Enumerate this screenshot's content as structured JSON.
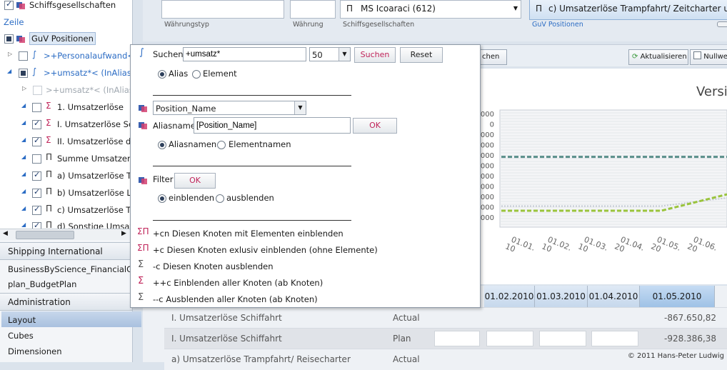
{
  "tree": {
    "top_item": "Schiffsgesellschaften",
    "section_label": "Zeile",
    "guv_label": "GuV Positionen",
    "items": [
      {
        "label": ">+Personalaufwand<"
      },
      {
        "label": ">+umsatz*< (InAlias)"
      },
      {
        "label": ">+umsatz*< (InAlias)"
      },
      {
        "label": "1. Umsatzerlöse"
      },
      {
        "label": "I. Umsatzerlöse Sch"
      },
      {
        "label": "II. Umsatzerlöse de"
      },
      {
        "label": "Summe Umsatzerl"
      },
      {
        "label": "a) Umsatzerlöse Tra"
      },
      {
        "label": "b) Umsatzerlöse Lir"
      },
      {
        "label": "c) Umsatzerlöse Tra"
      },
      {
        "label": "d) Sonstige Umsatz"
      }
    ]
  },
  "nav": {
    "header1": "Shipping International",
    "item1": "BusinessByScience_FinancialCub",
    "item2": "plan_BudgetPlan",
    "header2": "Administration",
    "layout": "Layout",
    "cubes": "Cubes",
    "dimensionen": "Dimensionen"
  },
  "filters": {
    "label1": "Währungstyp",
    "label2": "Währung",
    "label3": "Schiffsgesellschaften",
    "ship_value": "MS Icoaraci (612)",
    "guv_value": "c) Umsatzerlöse Trampfahrt/ Zeitcharter und ähr",
    "guv_label": "GuV Positionen"
  },
  "toolbar": {
    "partial": "chen",
    "refresh": "Aktualisieren",
    "nullwerte": "Nullwer"
  },
  "chart": {
    "title": "Versi"
  },
  "chart_data": {
    "type": "line",
    "title": "Versi",
    "y_tick_labels": [
      "000",
      "0",
      "000",
      "000",
      "000",
      "000",
      "000",
      "000",
      "000",
      "000",
      "000"
    ],
    "x": [
      "01.01.2010",
      "01.02.2010",
      "01.03.2010",
      "01.04.2010",
      "01.05.2010",
      "01.06.2010"
    ],
    "x_tick_labels": [
      [
        "01.01.",
        "10"
      ],
      [
        "01.02.",
        "10"
      ],
      [
        "01.03.",
        "10"
      ],
      [
        "01.04.",
        "20"
      ],
      [
        "01.05.",
        "20"
      ],
      [
        "01.06.",
        "20"
      ]
    ],
    "series": [
      {
        "values": [
          4.0,
          4.0,
          4.0,
          4.0,
          4.0,
          4.0
        ],
        "color": "#5a8f8a",
        "style": "dashed"
      },
      {
        "values": [
          8.2,
          8.2,
          8.2,
          8.2,
          8.2,
          7.5
        ],
        "color": "#c5cbd4",
        "style": "dotted"
      },
      {
        "values": [
          8.6,
          8.6,
          8.6,
          8.6,
          8.6,
          7.2
        ],
        "color": "#9ac43c",
        "style": "dashed"
      }
    ],
    "ylim": [
      0,
      10
    ],
    "grid": true
  },
  "table": {
    "headers": [
      "01.02.2010",
      "01.03.2010",
      "01.04.2010",
      "01.05.2010"
    ],
    "rows": [
      {
        "name": "I. Umsatzerlöse Schiffahrt",
        "type": "Actual",
        "value": "-867.650,82"
      },
      {
        "name": "I. Umsatzerlöse Schiffahrt",
        "type": "Plan",
        "value": "-928.386,38"
      },
      {
        "name": "a) Umsatzerlöse Trampfahrt/ Reisecharter",
        "type": "Actual",
        "value": ""
      }
    ],
    "copyright": "© 2011 Hans-Peter Ludwig"
  },
  "popup": {
    "search_label": "Suchen",
    "search_value": "+umsatz*",
    "count_value": "50",
    "search_button": "Suchen",
    "reset_button": "Reset",
    "alias_option": "Alias",
    "element_option": "Element",
    "position_select": "Position_Name",
    "aliasname_label": "Aliasname",
    "aliasname_value": "[Position_Name]",
    "ok_button": "OK",
    "aliasnamen_option": "Aliasnamen",
    "elementnamen_option": "Elementnamen",
    "filter_label": "Filter",
    "filter_ok": "OK",
    "einblenden_option": "einblenden",
    "ausblenden_option": "ausblenden",
    "commands": [
      {
        "icon": "ΣΠ",
        "text": "+cn Diesen Knoten mit Elementen einblenden"
      },
      {
        "icon": "ΣΠ",
        "text": "+c Diesen Knoten exlusiv einblenden (ohne Elemente)"
      },
      {
        "icon": "Σ",
        "text": "-c Diesen Knoten ausblenden"
      },
      {
        "icon": "Σ",
        "text": "++c Einblenden aller Knoten (ab Knoten)"
      },
      {
        "icon": "Σ",
        "text": "--c Ausblenden aller Knoten (ab Knoten)"
      }
    ]
  }
}
